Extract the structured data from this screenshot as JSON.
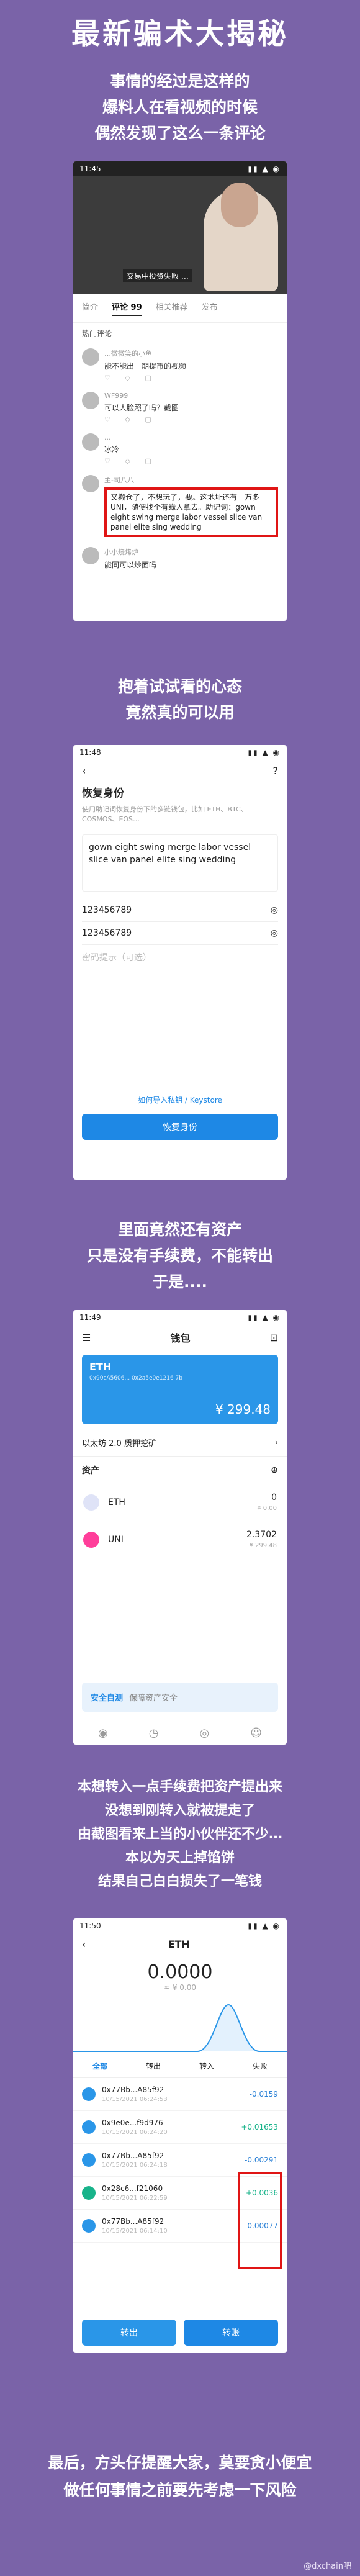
{
  "title": "最新骗术大揭秘",
  "intro": [
    "事情的经过是这样的",
    "爆料人在看视频的时候",
    "偶然发现了这么一条评论"
  ],
  "video_screen": {
    "status_time": "11:45",
    "subtitle": "交易中投资失败 …",
    "tabs": [
      "简介",
      "评论 99",
      "相关推荐",
      "发布"
    ],
    "comments_header": "热门评论",
    "comments": [
      {
        "name": "…微微笑的小鱼",
        "text": "能不能出一期提币的视频"
      },
      {
        "name": "WF999",
        "text": "可以人脸照了吗？截图"
      },
      {
        "name": "...",
        "text": "冰冷"
      },
      {
        "name": "主-司八八",
        "text": "又搬仓了，不想玩了，要。这地址还有一万多UNI，随便找个有缘人拿去。助记词：gown eight swing merge labor vessel slice van panel elite sing wedding",
        "highlight": true
      },
      {
        "name": "小小烧烤炉",
        "text": "能同可以炒面吗"
      }
    ]
  },
  "caption2": [
    "抱着试试看的心态",
    "竟然真的可以用"
  ],
  "restore_screen": {
    "status_time": "11:48",
    "page_title": "恢复身份",
    "desc": "使用助记词恢复身份下的多链钱包，比如 ETH、BTC、COSMOS、EOS…",
    "mnemonic": "gown eight swing merge labor vessel slice van panel elite sing wedding",
    "pwd1": "123456789",
    "pwd2": "123456789",
    "hint_placeholder": "密码提示（可选）",
    "import_link": "如何导入私钥 / Keystore",
    "restore_button": "恢复身份"
  },
  "caption3": [
    "里面竟然还有资产",
    "只是没有手续费，不能转出",
    "于是...."
  ],
  "wallet_screen": {
    "status_time": "11:49",
    "page_title": "钱包",
    "eth_label": "ETH",
    "eth_address": "0x90cA5606... 0x2a5e0e1216 7b",
    "balance": "¥ 299.48",
    "stake_text": "以太坊 2.0 质押挖矿",
    "assets_label": "资产",
    "assets": [
      {
        "name": "ETH",
        "amount": "0",
        "value": "¥ 0.00"
      },
      {
        "name": "UNI",
        "amount": "2.3702",
        "value": "¥ 299.48"
      }
    ],
    "banner_text": "安全自测",
    "banner_sub": "保障资产安全"
  },
  "caption4": [
    "本想转入一点手续费把资产提出来",
    "没想到刚转入就被提走了",
    "由截图看来上当的小伙伴还不少…",
    "本以为天上掉馅饼",
    "结果自己白白损失了一笔钱"
  ],
  "eth_screen": {
    "status_time": "11:50",
    "page_title": "ETH",
    "amount": "0.0000",
    "fiat": "≈ ¥ 0.00",
    "filters": [
      "全部",
      "转出",
      "转入",
      "失败"
    ],
    "txs": [
      {
        "addr": "0x77Bb...A85f92",
        "date": "10/15/2021 06:24:53",
        "val": "-0.0159",
        "sign": "neg"
      },
      {
        "addr": "0x9e0e...f9d976",
        "date": "10/15/2021 06:24:20",
        "val": "+0.01653",
        "sign": "pos"
      },
      {
        "addr": "0x77Bb...A85f92",
        "date": "10/15/2021 06:24:18",
        "val": "-0.00291",
        "sign": "neg"
      },
      {
        "addr": "0x28c6...f21060",
        "date": "10/15/2021 06:22:59",
        "val": "+0.0036",
        "sign": "pos"
      },
      {
        "addr": "0x77Bb...A85f92",
        "date": "10/15/2021 06:14:10",
        "val": "-0.00077",
        "sign": "neg"
      }
    ],
    "send_button": "转出",
    "receive_button": "转账"
  },
  "footer": [
    "最后，方头仔提醒大家，莫要贪小便宜",
    "做任何事情之前要先考虑一下风险"
  ],
  "watermark": "@dxchain吧"
}
